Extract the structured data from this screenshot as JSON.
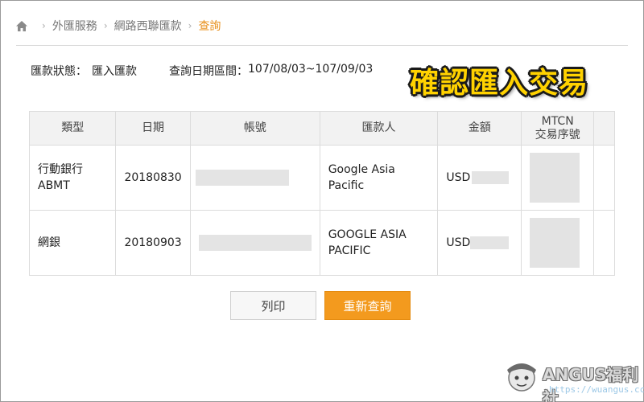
{
  "breadcrumb": {
    "items": [
      "外匯服務",
      "網路西聯匯款"
    ],
    "current": "查詢"
  },
  "status": {
    "state_label": "匯款狀態：",
    "state_value": "匯入匯款",
    "period_label": "查詢日期區間：",
    "period_value": "107/08/03~107/09/03"
  },
  "overlay_title": "確認匯入交易",
  "table": {
    "headers": [
      "類型",
      "日期",
      "帳號",
      "匯款人",
      "金額",
      "MTCN",
      "交易序號"
    ],
    "rows": [
      {
        "type": "行動銀行 ABMT",
        "date": "20180830",
        "payer": "Google Asia Pacific",
        "currency": "USD"
      },
      {
        "type": "網銀",
        "date": "20180903",
        "payer": "GOOGLE ASIA PACIFIC",
        "currency": "USD"
      }
    ]
  },
  "buttons": {
    "print": "列印",
    "requery": "重新查詢"
  },
  "watermark": {
    "name": "ANGUS福利社",
    "url": "https://wuangus.cc"
  },
  "colors": {
    "accent": "#f39a1e",
    "breadcrumb_active": "#e8901c",
    "overlay_title": "#ffd200"
  },
  "icons": {
    "home": "home-icon",
    "separator": "chevron-right-icon"
  }
}
